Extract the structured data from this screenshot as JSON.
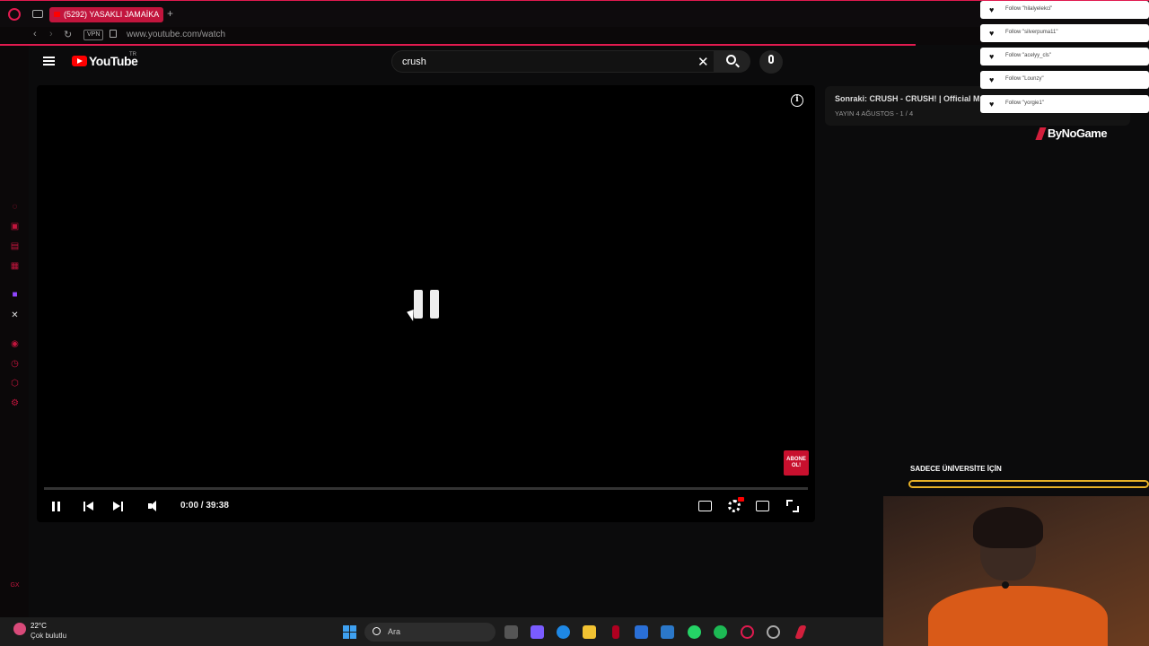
{
  "browser": {
    "tab_title": "(5292) YASAKLI JAMAİKA",
    "new_tab": "+",
    "vpn_label": "VPN",
    "url": "www.youtube.com/watch"
  },
  "youtube": {
    "logo_text": "YouTube",
    "logo_country": "TR",
    "search_value": "crush",
    "clear_symbol": "✕"
  },
  "player": {
    "info_symbol": "i",
    "time_display": "0:00 / 39:38",
    "abone_label": "ABONE OL!",
    "progress_fraction": 0.0
  },
  "up_next": {
    "title": "Sonraki: CRUSH - CRUSH! | Official Mus",
    "subtitle": "YAYIN 4 AĞUSTOS - 1 / 4"
  },
  "sponsor": {
    "name": "ByNoGame"
  },
  "follows": [
    {
      "label": "Follow \"hilalyelekci\""
    },
    {
      "label": "Follow \"silverpuma11\""
    },
    {
      "label": "Follow \"acelyy_cls\""
    },
    {
      "label": "Follow \"Lounzy\""
    },
    {
      "label": "Follow \"yorgie1\""
    }
  ],
  "overlay": {
    "university_text": "SADECE ÜNİVERSİTE İÇİN"
  },
  "taskbar": {
    "temperature": "22°C",
    "weather": "Çok bulutlu",
    "search_placeholder": "Ara"
  },
  "colors": {
    "accent": "#e01a4f",
    "youtube_red": "#ff0000",
    "bar_gold": "#e7b126"
  }
}
